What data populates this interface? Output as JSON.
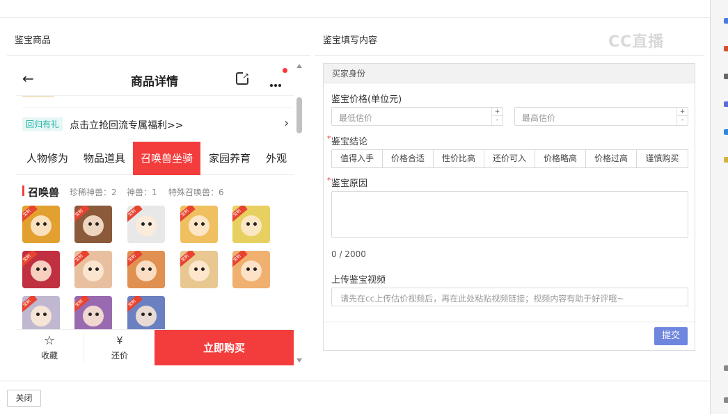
{
  "left_panel": {
    "title": "鉴宝商品"
  },
  "right_panel": {
    "title": "鉴宝填写内容"
  },
  "watermark": "CC直播",
  "product": {
    "header_title": "商品详情",
    "promo_tag": "回归有礼",
    "promo_text": "点击立抢回流专属福利>>",
    "tabs": [
      "人物修为",
      "物品道具",
      "召唤兽坐骑",
      "家园养育",
      "外观"
    ],
    "active_tab": 2,
    "section": {
      "title": "召唤兽",
      "stats": [
        "珍稀神兽：2",
        "神兽：1",
        "特殊召唤兽：6"
      ]
    },
    "pet_tag": "宝制",
    "pet_colors": [
      "#e2a030",
      "#8a5a3a",
      "#e8e8e8",
      "#f0c060",
      "#e8d060",
      "#c03040",
      "#e8c0a0",
      "#e09050",
      "#e8c890",
      "#f0b070",
      "#c0b8d0",
      "#9a6ab0",
      "#6a80c0"
    ],
    "bottom_bar": {
      "favorite": "收藏",
      "bargain": "还价",
      "buy": "立即购买"
    }
  },
  "form": {
    "header": "买家身份",
    "price_label": "鉴宝价格(单位元)",
    "min_placeholder": "最低估价",
    "max_placeholder": "最高估价",
    "conclusion_label": "鉴宝结论",
    "conclusions": [
      "值得入手",
      "价格合适",
      "性价比高",
      "还价可入",
      "价格略高",
      "价格过高",
      "谨慎购买"
    ],
    "reason_label": "鉴宝原因",
    "counter": "0 / 2000",
    "video_label": "上传鉴宝视频",
    "video_placeholder": "请先在cc上传估价视频后，再在此处粘贴视频链接；视频内容有助于好评哦~",
    "submit": "提交",
    "required_mark": "*"
  },
  "footer": {
    "close": "关闭"
  }
}
